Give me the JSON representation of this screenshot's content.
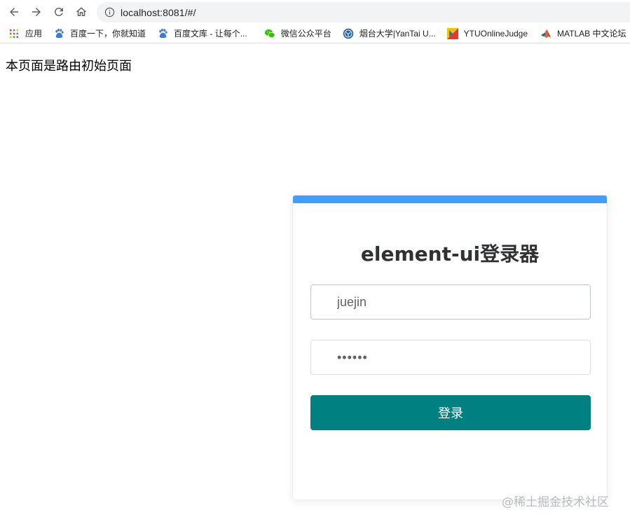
{
  "browser": {
    "url": "localhost:8081/#/",
    "bookmarks": [
      {
        "label": "应用",
        "icon": "apps-grid-icon"
      },
      {
        "label": "百度一下，你就知道",
        "icon": "baidu-paw-icon"
      },
      {
        "label": "百度文库 - 让每个...",
        "icon": "baidu-paw-icon"
      },
      {
        "label": "微信公众平台",
        "icon": "wechat-icon"
      },
      {
        "label": "烟台大学|YanTai U...",
        "icon": "ytu-logo-icon"
      },
      {
        "label": "YTUOnlineJudge",
        "icon": "ytuoj-logo-icon"
      },
      {
        "label": "MATLAB 中文论坛",
        "icon": "matlab-logo-icon"
      }
    ]
  },
  "page": {
    "intro_text": "本页面是路由初始页面"
  },
  "login": {
    "title": "element-ui登录器",
    "username_value": "juejin",
    "password_value": "••••••",
    "submit_label": "登录"
  },
  "watermark": "@稀土掘金技术社区",
  "colors": {
    "card_accent": "#409eff",
    "button_bg": "#008080"
  }
}
